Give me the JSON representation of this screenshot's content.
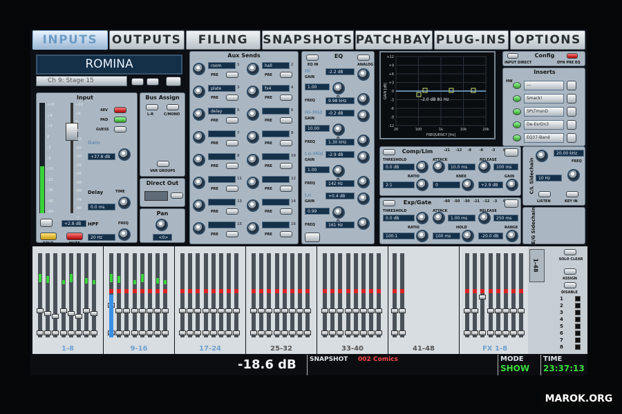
{
  "tabs": [
    "INPUTS",
    "OUTPUTS",
    "FILING",
    "SNAPSHOTS",
    "PATCHBAY",
    "PLUG-INS",
    "OPTIONS"
  ],
  "channel": {
    "name": "ROMINA",
    "selector": "Ch 9: Stage 15"
  },
  "input": {
    "title": "Input",
    "scale": [
      "+15",
      "+9",
      "+3",
      "0",
      "-3",
      "-9",
      "-15",
      "-21",
      "-30",
      "-40",
      "-60"
    ],
    "gain_scale": [
      "+12",
      "+6",
      "0",
      "-5",
      "-10",
      "-15",
      "-20",
      "-30",
      "-40",
      "-50",
      "-60",
      "-70",
      "-80",
      "-∞"
    ],
    "btn_48v": "48V",
    "btn_pad": "PAD",
    "btn_guess": "GUESS",
    "gain_label": "Gain",
    "gain_value": "+37.8 dB",
    "delay_label": "Delay",
    "time_label": "TIME",
    "delay_value": "0.0 ms",
    "hpf_label": "HPF",
    "freq_label": "FREQ",
    "hpf_value": "20 Hz",
    "fader_value": "+2.8 dB",
    "solo": "SOLO",
    "mute": "MUTE"
  },
  "bus_assign": {
    "title": "Bus Assign",
    "lr": "L-R",
    "cmono": "C/MONO",
    "var_groups": "VAR GROUPS"
  },
  "direct_out": {
    "title": "Direct Out"
  },
  "pan": {
    "title": "Pan",
    "value": "<0>"
  },
  "aux_sends": {
    "title": "Aux Sends",
    "rows": [
      {
        "left": "room",
        "right": "hall",
        "nl": "1",
        "nr": "2"
      },
      {
        "left": "plate",
        "right": "fx4",
        "nl": "3",
        "nr": "4"
      },
      {
        "left": "delay",
        "right": "",
        "nl": "5",
        "nr": "6"
      },
      {
        "left": "",
        "right": "",
        "nl": "7",
        "nr": "8"
      },
      {
        "left": "",
        "right": "",
        "nl": "9",
        "nr": "10"
      },
      {
        "left": "",
        "right": "",
        "nl": "11",
        "nr": "12"
      },
      {
        "left": "",
        "right": "",
        "nl": "13",
        "nr": "14"
      },
      {
        "left": "",
        "right": "",
        "nl": "15",
        "nr": "16"
      }
    ],
    "pre": "PRE"
  },
  "eq": {
    "title": "EQ",
    "eq_in": "EQ IN",
    "analog": "ANALOG",
    "bands": [
      {
        "name": "Hi",
        "gain": "-2.2 dB",
        "q": "1.00",
        "freq": "9.98 kHz"
      },
      {
        "name": "Hi-Mid",
        "gain": "-0.2 dB",
        "q": "10.00",
        "freq": "1.30 kHz"
      },
      {
        "name": "Lo-Mid",
        "gain": "-2.9 dB",
        "q": "1.00",
        "freq": "142 Hz"
      },
      {
        "name": "Lo",
        "gain": "+0.4 dB",
        "q": "0.99",
        "freq": "161 Hz"
      }
    ],
    "gain_label": "GAIN",
    "q_label": "Q",
    "freq_label": "FREQ"
  },
  "graph": {
    "ylabel": "GAIN [dB]",
    "xlabel": "FREQUENCY [Hz]",
    "yticks": [
      "+12",
      "+9",
      "+6",
      "+3",
      "0",
      "-3",
      "-6",
      "-9",
      "-12"
    ],
    "xticks": [
      "20",
      "100",
      "1k",
      "10k",
      "20k"
    ],
    "readout": "-2.0 dB  81 Hz"
  },
  "config": {
    "title": "Config",
    "input_direct": "INPUT DIRECT",
    "dyn_pre_eq": "DYN PRE EQ"
  },
  "inserts": {
    "title": "Inserts",
    "items": [
      "---",
      "Smack!",
      "SPLTmsnD",
      "De-EsrDn3",
      "EQ37-Band"
    ],
    "hw": "HW"
  },
  "comp": {
    "title": "Comp/Lim",
    "meter_scale": [
      "-21",
      "-12",
      "-9",
      "-6",
      "-3",
      "0"
    ],
    "threshold_label": "THRESHOLD",
    "threshold": "0.0 dB",
    "attack_label": "ATTACK",
    "attack": "10.0 ms",
    "release_label": "RELEASE",
    "release": "100 ms",
    "ratio_label": "RATIO",
    "ratio": "2:1",
    "knee_label": "KNEE",
    "knee": "0",
    "gain_label": "GAIN",
    "gain": "+2.9 dB"
  },
  "sidechain_cl": {
    "title": "C/L Sidechain",
    "freq1": "20.00 kHz",
    "freq_label": "FREQ",
    "freq2": "10 Hz",
    "listen": "LISTEN",
    "key_in": "KEY IN"
  },
  "gate": {
    "title": "Exp/Gate",
    "meter_scale": [
      "-60",
      "-50",
      "-30",
      "-21",
      "-12",
      "-3",
      "0"
    ],
    "threshold_label": "THRESHOLD",
    "threshold": "0.0 dB",
    "attack_label": "ATTACK",
    "attack": "1.00 ms",
    "release_label": "RELEASE",
    "release": "250 ms",
    "ratio_label": "RATIO",
    "ratio": "100:1",
    "hold_label": "HOLD",
    "hold": "100 ms",
    "range_label": "RANGE",
    "range": "-20.0 dB"
  },
  "sidechain_eg": {
    "title": "E/G Sidechain"
  },
  "banks": [
    "1-8",
    "9-16",
    "17-24",
    "25-32",
    "33-40",
    "41-48",
    "FX 1-8"
  ],
  "side": {
    "range": "1-48",
    "solo_clear": "SOLO CLEAR",
    "assign": "ASSIGN",
    "disable": "DISABLE",
    "nums": [
      "1",
      "2",
      "3",
      "4",
      "5",
      "6",
      "7",
      "8"
    ]
  },
  "status": {
    "level": "-18.6 dB",
    "snapshot_label": "SNAPSHOT",
    "snapshot": "002 Comics",
    "mode_label": "MODE",
    "mode": "SHOW",
    "time_label": "TIME",
    "time": "23:37:13"
  },
  "watermark": "MAROK.ORG",
  "colors": {
    "accent": "#7fb4e6",
    "red": "#e02020",
    "green": "#36d236",
    "yellow": "#ffd34d"
  }
}
